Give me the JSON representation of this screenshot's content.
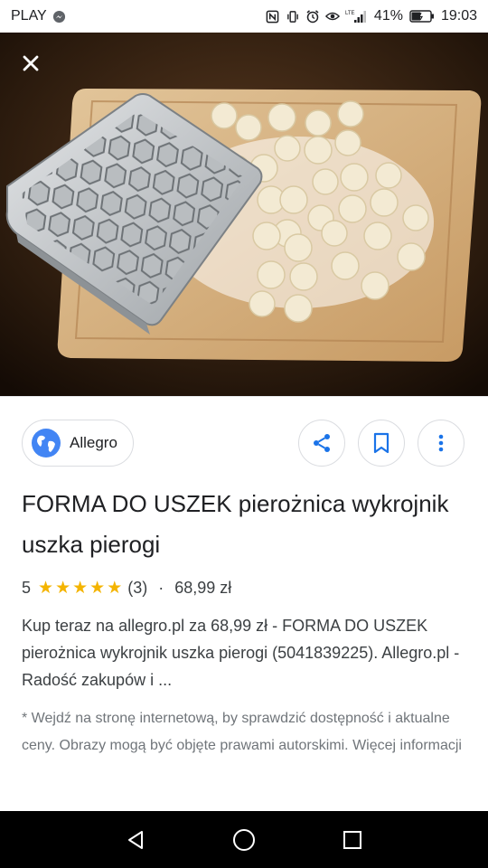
{
  "status_bar": {
    "carrier": "PLAY",
    "battery": "41%",
    "time": "19:03",
    "network": "LTE"
  },
  "result": {
    "source_name": "Allegro",
    "title": "FORMA DO USZEK pierożnica wykrojnik uszka pierogi",
    "rating_value": "5",
    "rating_stars": 5,
    "review_count": "(3)",
    "separator": "·",
    "price": "68,99 zł",
    "description": "Kup teraz na allegro.pl za 68,99 zł - FORMA DO USZEK pierożnica wykrojnik uszka pierogi (5041839225). Allegro.pl - Radość zakupów i ...",
    "note": "* Wejdź na stronę internetową, by sprawdzić dostępność i aktualne ceny. Obrazy mogą być objęte prawami autorskimi. Więcej informacji"
  },
  "icons": {
    "close": "close-icon",
    "globe": "globe-icon",
    "share": "share-icon",
    "bookmark": "bookmark-icon",
    "more": "more-vert-icon",
    "back": "back-icon",
    "home": "home-icon",
    "recents": "recents-icon"
  },
  "colors": {
    "accent": "#1a73e8",
    "star": "#f4b400",
    "globe": "#4285f4"
  }
}
